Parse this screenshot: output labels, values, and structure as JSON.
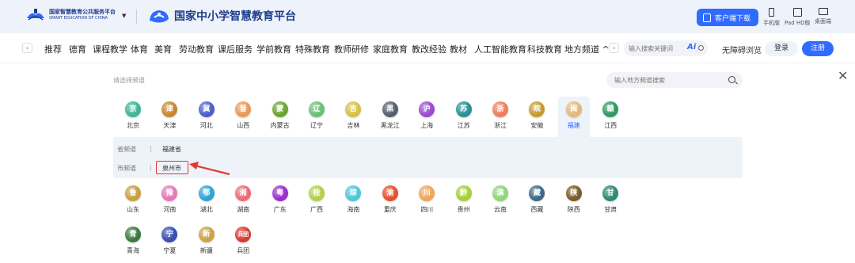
{
  "header": {
    "platform_name_cn": "国家智慧教育公共服务平台",
    "platform_name_en": "SMART EDUCATION OF CHINA",
    "site_title": "国家中小学智慧教育平台",
    "download_label": "客户端下载",
    "devices": [
      {
        "label": "手机版",
        "icon": "phone-icon"
      },
      {
        "label": "Pad HD版",
        "icon": "tablet-icon"
      },
      {
        "label": "桌面端",
        "icon": "desktop-icon"
      }
    ]
  },
  "nav": {
    "items": [
      "推荐",
      "德育",
      "课程教学",
      "体育",
      "美育",
      "劳动教育",
      "课后服务",
      "学前教育",
      "特殊教育",
      "教师研修",
      "家庭教育",
      "教改经验",
      "教材",
      "人工智能教育",
      "科技教育",
      "地方频道 ^"
    ],
    "search_placeholder": "输入搜索关键词",
    "ai_label": "Ai",
    "accessibility": "无障碍浏览",
    "login": "登录",
    "register": "注册"
  },
  "channel_panel": {
    "label": "请选择频道",
    "search_placeholder": "输入地方频道搜索",
    "selected_province": "福建",
    "provinces_row1": [
      {
        "abbr": "京",
        "name": "北京",
        "color": "#3fb596"
      },
      {
        "abbr": "津",
        "name": "天津",
        "color": "#c9872c"
      },
      {
        "abbr": "冀",
        "name": "河北",
        "color": "#4c5fc9"
      },
      {
        "abbr": "晋",
        "name": "山西",
        "color": "#e89a5a"
      },
      {
        "abbr": "蒙",
        "name": "内蒙古",
        "color": "#6aa62e"
      },
      {
        "abbr": "辽",
        "name": "辽宁",
        "color": "#69c07a"
      },
      {
        "abbr": "吉",
        "name": "吉林",
        "color": "#d4c24a"
      },
      {
        "abbr": "黑",
        "name": "黑龙江",
        "color": "#55606e"
      },
      {
        "abbr": "沪",
        "name": "上海",
        "color": "#9a4bd1"
      },
      {
        "abbr": "苏",
        "name": "江苏",
        "color": "#2b8f95"
      },
      {
        "abbr": "浙",
        "name": "浙江",
        "color": "#ef7d5b"
      },
      {
        "abbr": "皖",
        "name": "安徽",
        "color": "#c99a2b"
      },
      {
        "abbr": "闽",
        "name": "福建",
        "color": "#e3b879"
      },
      {
        "abbr": "赣",
        "name": "江西",
        "color": "#2f9a62"
      }
    ],
    "sub_channels": {
      "province_label": "省频道",
      "province_value": "福建省",
      "city_label": "市频道",
      "city_value": "泉州市"
    },
    "provinces_row2": [
      {
        "abbr": "鲁",
        "name": "山东",
        "color": "#c9a040"
      },
      {
        "abbr": "豫",
        "name": "河南",
        "color": "#e677b8"
      },
      {
        "abbr": "鄂",
        "name": "湖北",
        "color": "#2fa3d6"
      },
      {
        "abbr": "湘",
        "name": "湖南",
        "color": "#ef6a78"
      },
      {
        "abbr": "粤",
        "name": "广东",
        "color": "#9c2fc9"
      },
      {
        "abbr": "桂",
        "name": "广西",
        "color": "#b2d14a"
      },
      {
        "abbr": "琼",
        "name": "海南",
        "color": "#4ec8d8"
      },
      {
        "abbr": "渝",
        "name": "重庆",
        "color": "#e8502e"
      },
      {
        "abbr": "川",
        "name": "四川",
        "color": "#f0a55a"
      },
      {
        "abbr": "黔",
        "name": "贵州",
        "color": "#a6d13a"
      },
      {
        "abbr": "滇",
        "name": "云南",
        "color": "#8fd67a"
      },
      {
        "abbr": "藏",
        "name": "西藏",
        "color": "#3d6a8a"
      },
      {
        "abbr": "陕",
        "name": "陕西",
        "color": "#7a5c28"
      },
      {
        "abbr": "甘",
        "name": "甘肃",
        "color": "#2f8a74"
      }
    ],
    "provinces_row3": [
      {
        "abbr": "青",
        "name": "青海",
        "color": "#3b7a3e"
      },
      {
        "abbr": "宁",
        "name": "宁夏",
        "color": "#3a4fb0"
      },
      {
        "abbr": "新",
        "name": "新疆",
        "color": "#d1a144"
      },
      {
        "abbr": "兵团",
        "name": "兵团",
        "color": "#d93a2f"
      }
    ]
  },
  "colors": {
    "accent": "#2f6bff",
    "header_bg": "#eef3fb",
    "highlight_red": "#e53935"
  }
}
